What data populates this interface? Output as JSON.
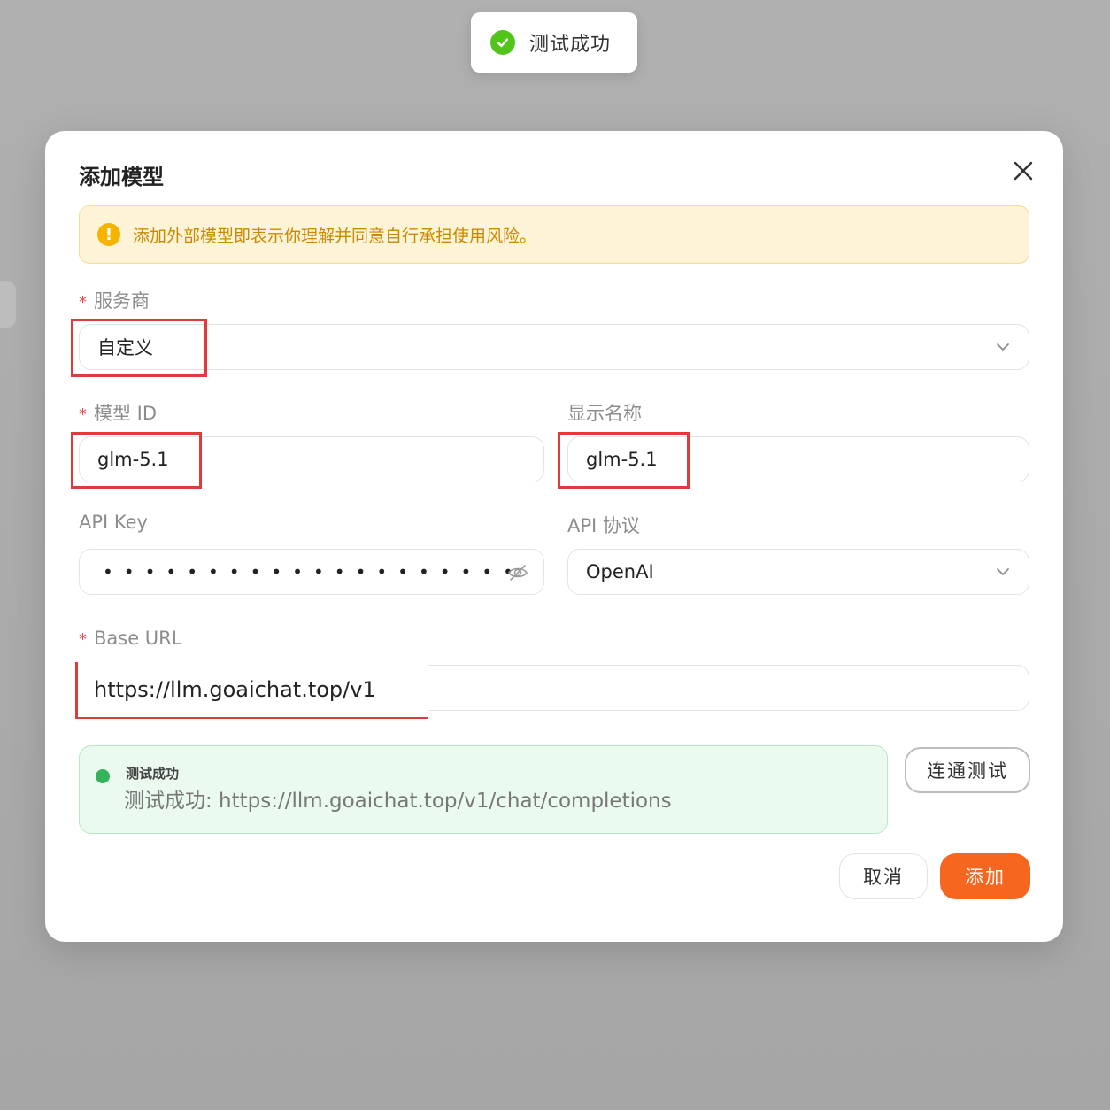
{
  "toast": {
    "message": "测试成功"
  },
  "modal": {
    "title": "添加模型",
    "warning": "添加外部模型即表示你理解并同意自行承担使用风险。",
    "provider": {
      "required_mark": "*",
      "label": "服务商",
      "value": "自定义"
    },
    "model_id": {
      "required_mark": "*",
      "label": "模型 ID",
      "value": "glm-5.1"
    },
    "display_name": {
      "label": "显示名称",
      "value": "glm-5.1"
    },
    "api_key": {
      "label": "API Key",
      "masked_value": "••••••••••••••••••••"
    },
    "api_protocol": {
      "label": "API 协议",
      "value": "OpenAI"
    },
    "base_url": {
      "required_mark": "*",
      "label": "Base URL",
      "value": "https://llm.goaichat.top/v1"
    },
    "test_result": {
      "title": "测试成功",
      "detail": "测试成功: https://llm.goaichat.top/v1/chat/completions",
      "status_color": "#33b35a"
    },
    "buttons": {
      "test": "连通测试",
      "cancel": "取消",
      "add": "添加"
    }
  },
  "colors": {
    "accent": "#f7661f",
    "success": "#52c41a",
    "warning": "#f5b400",
    "highlight": "#e03a3a"
  },
  "icons": [
    "check-circle-icon",
    "close-icon",
    "warning-icon",
    "chevron-down-icon",
    "eye-off-icon",
    "status-dot-icon"
  ]
}
